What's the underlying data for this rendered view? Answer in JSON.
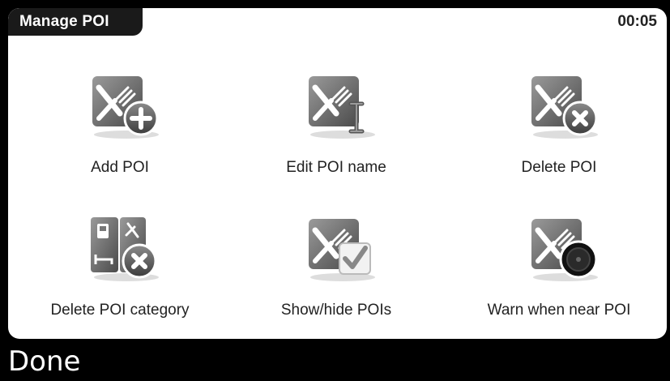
{
  "header": {
    "title": "Manage POI",
    "clock": "00:05"
  },
  "menu": {
    "items": [
      {
        "label": "Add POI",
        "icon": "add-poi-icon"
      },
      {
        "label": "Edit POI name",
        "icon": "edit-poi-name-icon"
      },
      {
        "label": "Delete POI",
        "icon": "delete-poi-icon"
      },
      {
        "label": "Delete POI category",
        "icon": "delete-poi-category-icon"
      },
      {
        "label": "Show/hide POIs",
        "icon": "show-hide-pois-icon"
      },
      {
        "label": "Warn when near POI",
        "icon": "warn-near-poi-icon"
      }
    ]
  },
  "footer": {
    "done_label": "Done"
  },
  "colors": {
    "background": "#000000",
    "panel": "#ffffff",
    "title_tab": "#1a1a1a",
    "icon_card": "#7a7a7a"
  }
}
